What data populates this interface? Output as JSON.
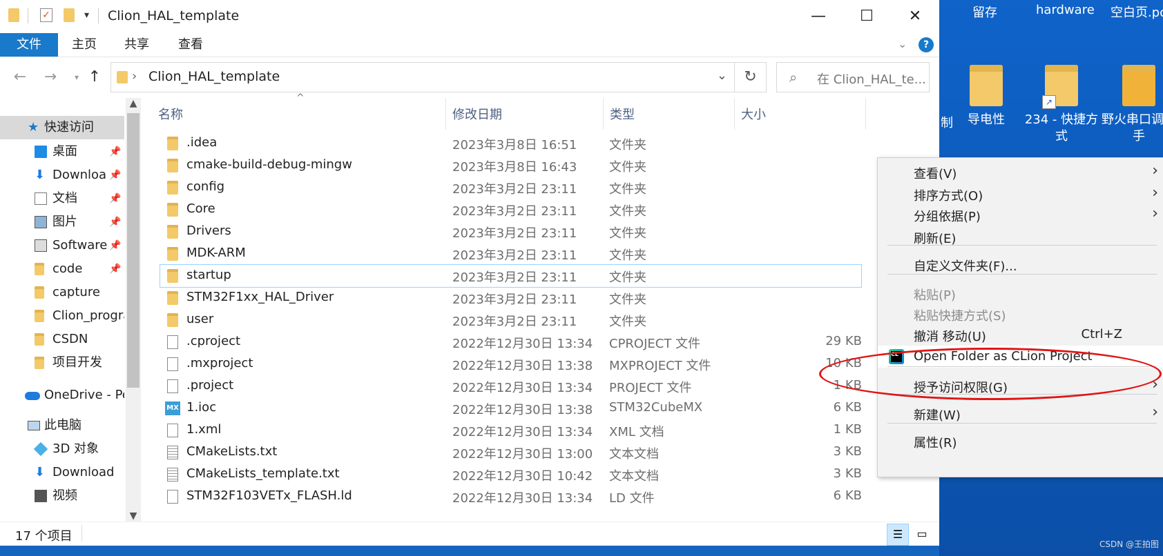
{
  "window": {
    "title": "Clion_HAL_template",
    "controls": {
      "minimize": "—",
      "maximize": "☐",
      "close": "✕"
    }
  },
  "ribbon": {
    "tabs": [
      "文件",
      "主页",
      "共享",
      "查看"
    ]
  },
  "address": {
    "crumb": "Clion_HAL_template",
    "search_placeholder": "在 Clion_HAL_te..."
  },
  "nav": {
    "quick_access": "快速访问",
    "items": [
      {
        "label": "桌面",
        "pinned": true
      },
      {
        "label": "Downloa",
        "pinned": true
      },
      {
        "label": "文档",
        "pinned": true
      },
      {
        "label": "图片",
        "pinned": true
      },
      {
        "label": "Software",
        "pinned": true
      },
      {
        "label": "code",
        "pinned": true
      },
      {
        "label": "capture",
        "pinned": false
      },
      {
        "label": "Clion_progra",
        "pinned": false
      },
      {
        "label": "CSDN",
        "pinned": false
      },
      {
        "label": "项目开发",
        "pinned": false
      }
    ],
    "onedrive": "OneDrive - Pe",
    "this_pc": "此电脑",
    "pc_items": [
      "3D 对象",
      "Download",
      "视频"
    ]
  },
  "columns": {
    "name": "名称",
    "date": "修改日期",
    "type": "类型",
    "size": "大小"
  },
  "files": [
    {
      "name": ".idea",
      "date": "2023年3月8日 16:51",
      "type": "文件夹",
      "size": "",
      "icon": "folder"
    },
    {
      "name": "cmake-build-debug-mingw",
      "date": "2023年3月8日 16:43",
      "type": "文件夹",
      "size": "",
      "icon": "folder"
    },
    {
      "name": "config",
      "date": "2023年3月2日 23:11",
      "type": "文件夹",
      "size": "",
      "icon": "folder"
    },
    {
      "name": "Core",
      "date": "2023年3月2日 23:11",
      "type": "文件夹",
      "size": "",
      "icon": "folder"
    },
    {
      "name": "Drivers",
      "date": "2023年3月2日 23:11",
      "type": "文件夹",
      "size": "",
      "icon": "folder"
    },
    {
      "name": "MDK-ARM",
      "date": "2023年3月2日 23:11",
      "type": "文件夹",
      "size": "",
      "icon": "folder"
    },
    {
      "name": "startup",
      "date": "2023年3月2日 23:11",
      "type": "文件夹",
      "size": "",
      "icon": "folder"
    },
    {
      "name": "STM32F1xx_HAL_Driver",
      "date": "2023年3月2日 23:11",
      "type": "文件夹",
      "size": "",
      "icon": "folder"
    },
    {
      "name": "user",
      "date": "2023年3月2日 23:11",
      "type": "文件夹",
      "size": "",
      "icon": "folder"
    },
    {
      "name": ".cproject",
      "date": "2022年12月30日 13:34",
      "type": "CPROJECT 文件",
      "size": "29 KB",
      "icon": "file"
    },
    {
      "name": ".mxproject",
      "date": "2022年12月30日 13:38",
      "type": "MXPROJECT 文件",
      "size": "10 KB",
      "icon": "file"
    },
    {
      "name": ".project",
      "date": "2022年12月30日 13:34",
      "type": "PROJECT 文件",
      "size": "1 KB",
      "icon": "file"
    },
    {
      "name": "1.ioc",
      "date": "2022年12月30日 13:38",
      "type": "STM32CubeMX",
      "size": "6 KB",
      "icon": "mx"
    },
    {
      "name": "1.xml",
      "date": "2022年12月30日 13:34",
      "type": "XML 文档",
      "size": "1 KB",
      "icon": "file"
    },
    {
      "name": "CMakeLists.txt",
      "date": "2022年12月30日 13:00",
      "type": "文本文档",
      "size": "3 KB",
      "icon": "txt"
    },
    {
      "name": "CMakeLists_template.txt",
      "date": "2022年12月30日 10:42",
      "type": "文本文档",
      "size": "3 KB",
      "icon": "txt"
    },
    {
      "name": "STM32F103VETx_FLASH.ld",
      "date": "2022年12月30日 13:34",
      "type": "LD 文件",
      "size": "6 KB",
      "icon": "file"
    }
  ],
  "status": {
    "count": "17 个项目"
  },
  "context_menu": {
    "items": [
      {
        "label": "查看(V)",
        "submenu": true,
        "disabled": false
      },
      {
        "label": "排序方式(O)",
        "submenu": true,
        "disabled": false
      },
      {
        "label": "分组依据(P)",
        "submenu": true,
        "disabled": false
      },
      {
        "label": "刷新(E)",
        "submenu": false,
        "disabled": false
      },
      {
        "label": "自定义文件夹(F)...",
        "submenu": false,
        "disabled": false
      },
      {
        "label": "粘贴(P)",
        "submenu": false,
        "disabled": true
      },
      {
        "label": "粘贴快捷方式(S)",
        "submenu": false,
        "disabled": true
      },
      {
        "label": "撤消 移动(U)",
        "submenu": false,
        "disabled": false,
        "shortcut": "Ctrl+Z"
      },
      {
        "label": "Open Folder as CLion Project",
        "submenu": false,
        "disabled": false
      },
      {
        "label": "授予访问权限(G)",
        "submenu": true,
        "disabled": false
      },
      {
        "label": "新建(W)",
        "submenu": true,
        "disabled": false
      },
      {
        "label": "属性(R)",
        "submenu": false,
        "disabled": false
      }
    ]
  },
  "desktop": {
    "top_labels": [
      "留存",
      "hardware",
      "空白页.pc"
    ],
    "icons": [
      {
        "label": "导电性"
      },
      {
        "label": "234 - 快捷方式"
      },
      {
        "label": "野火串口调助手"
      }
    ],
    "partial_left": "制",
    "watermark": "CSDN @王拍图"
  }
}
